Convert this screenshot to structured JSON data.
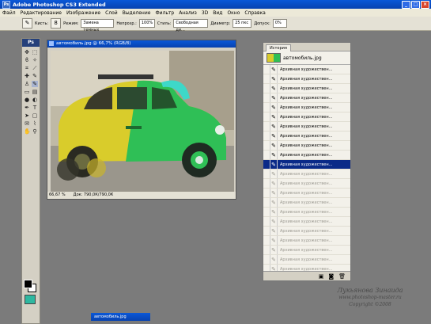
{
  "app": {
    "title": "Adobe Photoshop CS3 Extended",
    "icon": "photoshop-icon"
  },
  "window_buttons": [
    "minimize-icon",
    "maximize-icon",
    "close-icon"
  ],
  "menu": [
    "Файл",
    "Редактирование",
    "Изображение",
    "Слой",
    "Выделение",
    "Фильтр",
    "Анализ",
    "3D",
    "Вид",
    "Окно",
    "Справка"
  ],
  "options": {
    "brush_label": "Кисть:",
    "brush_value": "8",
    "mode_label": "Режим:",
    "mode_value": "Замена темных",
    "opacity_label": "Непрозр.:",
    "opacity_value": "100%",
    "style_label": "Стиль:",
    "style_value": "Свободная ди...",
    "area_label": "Диаметр:",
    "area_value": "25 пкс",
    "tolerance_label": "Допуск:",
    "tolerance_value": "0%"
  },
  "toolbox": {
    "badge": "Ps"
  },
  "document": {
    "title": "автомобиль.jpg @ 66,7% (RGB/8)",
    "zoom": "66,67 %",
    "doc_info": "Док: 790,0К/790,0К"
  },
  "history": {
    "tab": "История",
    "snapshot": "автомобиль.jpg",
    "items": [
      "Архивная художествен...",
      "Архивная художествен...",
      "Архивная художествен...",
      "Архивная художествен...",
      "Архивная художествен...",
      "Архивная художествен...",
      "Архивная художествен...",
      "Архивная художествен...",
      "Архивная художествен...",
      "Архивная художествен...",
      "Архивная художествен...",
      "Архивная художествен...",
      "Архивная художествен...",
      "Архивная художествен...",
      "Архивная художествен...",
      "Архивная художествен...",
      "Архивная художествен...",
      "Архивная художествен...",
      "Архивная художествен...",
      "Архивная художествен...",
      "Архивная художествен...",
      "Архивная художествен..."
    ],
    "active_index": 10,
    "footer_icons": [
      "new-document-from-state-icon",
      "camera-icon",
      "trash-icon"
    ]
  },
  "minimized": {
    "title": "автомобиль.jpg"
  },
  "watermark": {
    "line1": "Лукьянова Зинаида",
    "line2": "www.photoshop-master.ru",
    "line3": "Copyright ©2008"
  },
  "colors": {
    "titlebar": "#0a58d8",
    "active_history": "#0a2a88",
    "car_yellow": "#d9cc2b",
    "car_green": "#2fbf56"
  }
}
